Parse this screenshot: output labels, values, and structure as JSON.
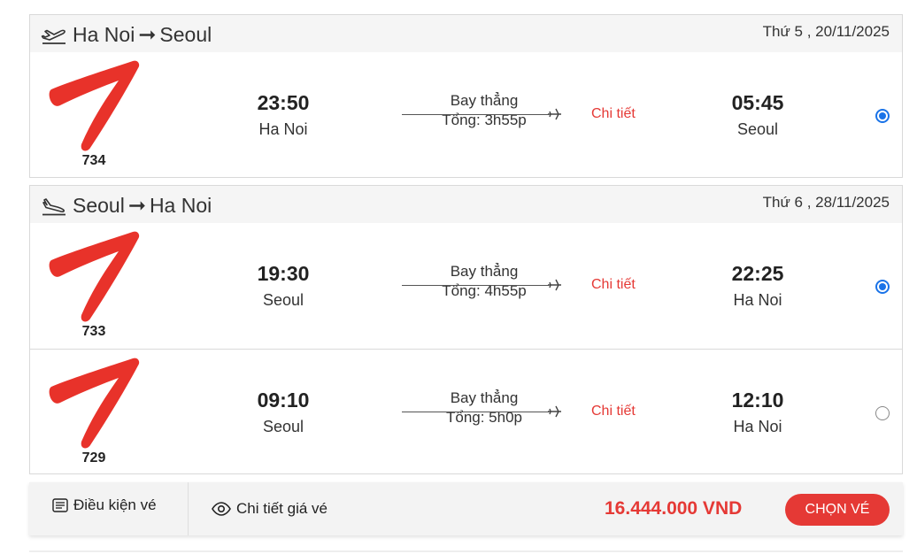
{
  "outbound": {
    "route_from": "Ha Noi",
    "route_to": "Seoul",
    "date": "Thứ 5 , 20/11/2025",
    "flights": [
      {
        "flight_no": "734",
        "dep_time": "23:50",
        "dep_city": "Ha Noi",
        "type": "Bay thẳng",
        "total": "Tổng: 3h55p",
        "detail": "Chi tiết",
        "arr_time": "05:45",
        "arr_city": "Seoul",
        "selected": true
      }
    ]
  },
  "return": {
    "route_from": "Seoul",
    "route_to": "Ha Noi",
    "date": "Thứ 6 , 28/11/2025",
    "flights": [
      {
        "flight_no": "733",
        "dep_time": "19:30",
        "dep_city": "Seoul",
        "type": "Bay thẳng",
        "total": "Tổng: 4h55p",
        "detail": "Chi tiết",
        "arr_time": "22:25",
        "arr_city": "Ha Noi",
        "selected": true
      },
      {
        "flight_no": "729",
        "dep_time": "09:10",
        "dep_city": "Seoul",
        "type": "Bay thẳng",
        "total": "Tổng: 5h0p",
        "detail": "Chi tiết",
        "arr_time": "12:10",
        "arr_city": "Ha Noi",
        "selected": false
      }
    ]
  },
  "footer": {
    "conditions": "Điều kiện vé",
    "price_detail": "Chi tiết giá vé",
    "total_price": "16.444.000 VND",
    "choose_button": "CHỌN VÉ"
  },
  "icons": {
    "takeoff": "airplane-takeoff-icon",
    "landing": "airplane-landing-icon",
    "plane": "airplane-icon",
    "logo": "airline-logo",
    "document": "document-icon",
    "eye": "eye-icon"
  },
  "colors": {
    "accent": "#e53935",
    "radio": "#1a73e8",
    "logo": "#e8322a"
  }
}
